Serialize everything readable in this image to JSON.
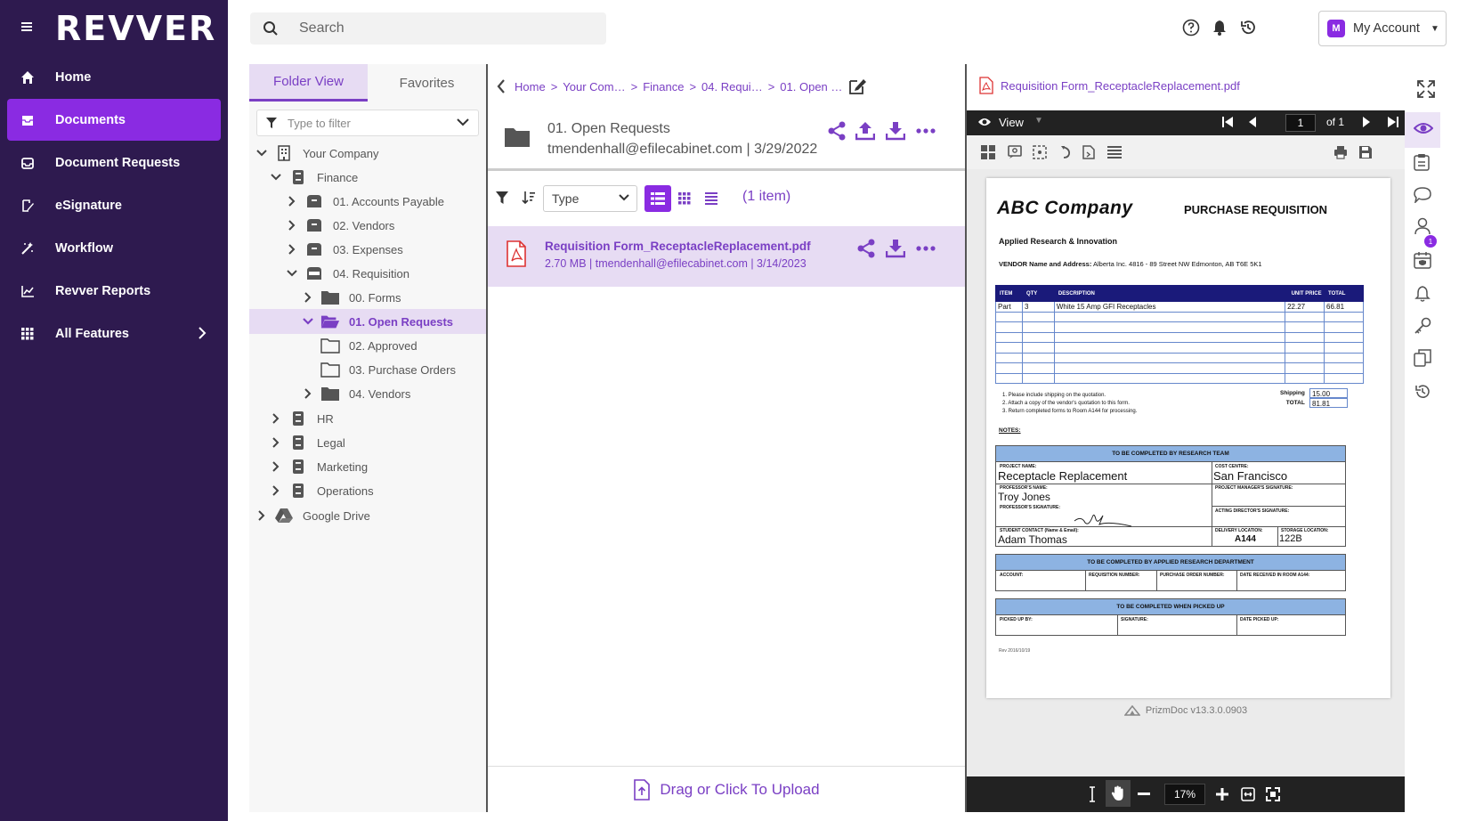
{
  "app": {
    "logo": "REVVER"
  },
  "sidebar": {
    "items": [
      {
        "label": "Home",
        "icon": "home-icon"
      },
      {
        "label": "Documents",
        "icon": "inbox-icon",
        "active": true
      },
      {
        "label": "Document Requests",
        "icon": "inbox-request-icon"
      },
      {
        "label": "eSignature",
        "icon": "signature-icon"
      },
      {
        "label": "Workflow",
        "icon": "workflow-icon"
      },
      {
        "label": "Revver Reports",
        "icon": "chart-icon"
      },
      {
        "label": "All Features",
        "icon": "grid-icon"
      }
    ]
  },
  "topbar": {
    "search_placeholder": "Search",
    "account_initial": "M",
    "account_label": "My Account"
  },
  "tree": {
    "tabs": [
      "Folder View",
      "Favorites"
    ],
    "filter_placeholder": "Type to filter",
    "nodes": [
      {
        "label": "Your Company"
      },
      {
        "label": "Finance"
      },
      {
        "label": "01. Accounts Payable"
      },
      {
        "label": "02. Vendors"
      },
      {
        "label": "03. Expenses"
      },
      {
        "label": "04. Requisition"
      },
      {
        "label": "00. Forms"
      },
      {
        "label": "01. Open Requests"
      },
      {
        "label": "02. Approved"
      },
      {
        "label": "03. Purchase Orders"
      },
      {
        "label": "04. Vendors"
      },
      {
        "label": "HR"
      },
      {
        "label": "Legal"
      },
      {
        "label": "Marketing"
      },
      {
        "label": "Operations"
      },
      {
        "label": "Google Drive"
      }
    ]
  },
  "breadcrumb": {
    "items": [
      "Home",
      "Your Com…",
      "Finance",
      "04. Requi…",
      "01. Open …"
    ]
  },
  "folder": {
    "name": "01. Open Requests",
    "meta": "tmendenhall@efilecabinet.com | 3/29/2022"
  },
  "list": {
    "type_select": "Type",
    "count": "(1 item)",
    "files": [
      {
        "name": "Requisition Form_ReceptacleReplacement.pdf",
        "meta": "2.70 MB | tmendenhall@efilecabinet.com | 3/14/2023"
      }
    ],
    "upload_label": "Drag or Click To Upload"
  },
  "viewer": {
    "filename": "Requisition Form_ReceptacleReplacement.pdf",
    "view_label": "View",
    "page_current": "1",
    "page_total": "of 1",
    "zoom": "17%",
    "footer": "PrizmDoc v13.3.0.0903",
    "notification_count": "1"
  },
  "document": {
    "company": "ABC Company",
    "title": "PURCHASE REQUISITION",
    "dept": "Applied Research & Innovation",
    "vendor_label": "VENDOR Name and Address:",
    "vendor": "Alberta Inc. 4816 - 89 Street NW Edmonton, AB T6E 5K1",
    "table_headers": [
      "ITEM",
      "QTY",
      "DESCRIPTION",
      "UNIT PRICE",
      "TOTAL"
    ],
    "row1": [
      "Part",
      "3",
      "White 15 Amp GFI Receptacles",
      "22.27",
      "66.81"
    ],
    "note1": "1.   Please include shipping on the quotation.",
    "note2": "2.   Attach a copy of the vendor's quotation to this form.",
    "note3": "3.   Return completed forms to Room A144 for processing.",
    "shipping_label": "Shipping",
    "total_label": "TOTAL",
    "shipping": "15.00",
    "total": "81.81",
    "notes_label": "NOTES:",
    "sec1_title": "TO BE COMPLETED BY RESEARCH TEAM",
    "project_name_label": "PROJECT NAME:",
    "project_name": "Receptacle Replacement",
    "cost_centre_label": "COST CENTRE:",
    "cost_centre": "San Francisco",
    "prof_name_label": "PROFESSOR'S NAME:",
    "prof_name": "Troy Jones",
    "pm_sig_label": "PROJECT MANAGER'S SIGNATURE:",
    "prof_sig_label": "PROFESSOR'S SIGNATURE:",
    "acting_label": "ACTING DIRECTOR'S SIGNATURE:",
    "student_label": "STUDENT CONTACT (Name & Email):",
    "student": "Adam Thomas",
    "delivery_label": "DELIVERY LOCATION:",
    "delivery": "A144",
    "storage_label": "STORAGE LOCATION:",
    "storage": "122B",
    "sec2_title": "TO BE COMPLETED BY APPLIED RESEARCH DEPARTMENT",
    "account_label": "ACCOUNT:",
    "req_num_label": "REQUISITION NUMBER:",
    "po_label": "PURCHASE ORDER NUMBER:",
    "date_recv_label": "DATE RECEIVED IN ROOM A144:",
    "sec3_title": "TO BE COMPLETED WHEN PICKED UP",
    "picked_by_label": "PICKED UP BY:",
    "signature_label": "SIGNATURE:",
    "date_picked_label": "DATE PICKED UP:",
    "rev": "Rev 2016/10/19"
  },
  "colors": {
    "sidebar_bg": "#2e1a4f",
    "accent": "#8a2be2",
    "accent_text": "#7a3fc4",
    "selected_bg": "#e7dcf3"
  }
}
